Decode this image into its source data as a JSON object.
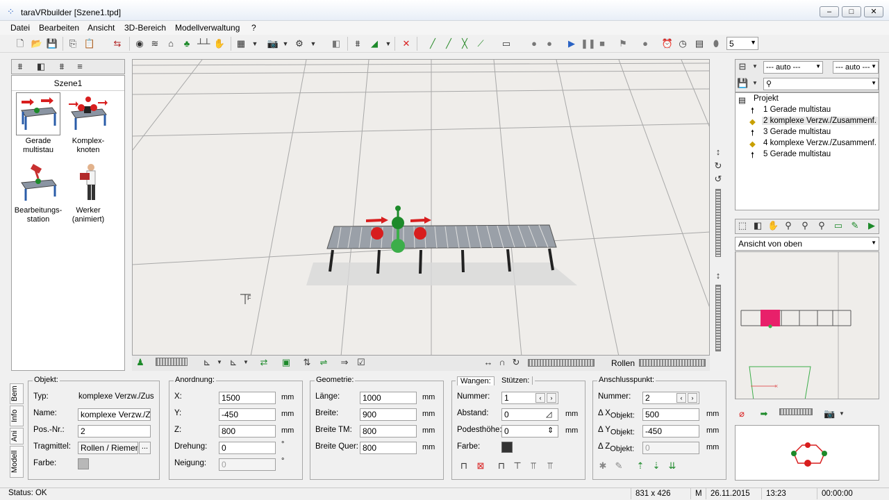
{
  "window": {
    "title": "taraVRbuilder [Szene1.tpd]"
  },
  "menu": [
    "Datei",
    "Bearbeiten",
    "Ansicht",
    "3D-Bereich",
    "Modellverwaltung",
    "?"
  ],
  "toolbar": {
    "count_value": "5"
  },
  "library": {
    "scene_label": "Szene1",
    "items": [
      {
        "label1": "Gerade",
        "label2": "multistau"
      },
      {
        "label1": "Komplex-",
        "label2": "knoten"
      },
      {
        "label1": "Bearbeitungs-",
        "label2": "station"
      },
      {
        "label1": "Werker",
        "label2": "(animiert)"
      }
    ]
  },
  "viewport": {
    "rollen_label": "Rollen"
  },
  "side_tabs": [
    "Bem",
    "Info",
    "Ani",
    "Modell"
  ],
  "objekt": {
    "title": "Objekt:",
    "typ_label": "Typ:",
    "typ_value": "komplexe Verzw./Zus",
    "name_label": "Name:",
    "name_value": "komplexe Verzw./Zus",
    "pos_label": "Pos.-Nr.:",
    "pos_value": "2",
    "tragmittel_label": "Tragmittel:",
    "tragmittel_value": "Rollen / Riemen",
    "farbe_label": "Farbe:"
  },
  "anordnung": {
    "title": "Anordnung:",
    "x_label": "X:",
    "x_value": "1500",
    "y_label": "Y:",
    "y_value": "-450",
    "z_label": "Z:",
    "z_value": "800",
    "drehung_label": "Drehung:",
    "drehung_value": "0",
    "neigung_label": "Neigung:",
    "neigung_value": "0",
    "unit_mm": "mm",
    "unit_deg": "°"
  },
  "geometrie": {
    "title": "Geometrie:",
    "laenge_label": "Länge:",
    "laenge_value": "1000",
    "breite_label": "Breite:",
    "breite_value": "900",
    "breite_tm_label": "Breite TM:",
    "breite_tm_value": "800",
    "breite_quer_label": "Breite Quer:",
    "breite_quer_value": "800",
    "unit_mm": "mm"
  },
  "wangen": {
    "tab1": "Wangen:",
    "tab2": "Stützen:",
    "nummer_label": "Nummer:",
    "nummer_value": "1",
    "abstand_label": "Abstand:",
    "abstand_value": "0",
    "podest_label": "Podesthöhe:",
    "podest_value": "0",
    "farbe_label": "Farbe:",
    "unit_mm": "mm"
  },
  "anschluss": {
    "title": "Anschlusspunkt:",
    "nummer_label": "Nummer:",
    "nummer_value": "2",
    "dx_label": "Δ X",
    "dx_sub": "Objekt:",
    "dx_value": "500",
    "dy_label": "Δ Y",
    "dy_sub": "Objekt:",
    "dy_value": "-450",
    "dz_label": "Δ Z",
    "dz_sub": "Objekt:",
    "dz_value": "0",
    "unit_mm": "mm"
  },
  "project_panel": {
    "auto1": "--- auto ---",
    "auto2": "--- auto ---",
    "root": "Projekt",
    "items": [
      {
        "label": "1  Gerade multistau"
      },
      {
        "label": "2  komplexe Verzw./Zusammenf."
      },
      {
        "label": "3  Gerade multistau"
      },
      {
        "label": "4  komplexe Verzw./Zusammenf."
      },
      {
        "label": "5  Gerade multistau"
      }
    ]
  },
  "view_panel": {
    "view_select": "Ansicht von oben"
  },
  "status": {
    "text": "Status: OK",
    "size": "831 x 426",
    "mode": "M",
    "date": "26.11.2015",
    "time": "13:23",
    "timer": "00:00:00"
  },
  "colors": {
    "accent_magenta": "#e8206a",
    "conveyor_red": "#d81e1e",
    "conveyor_green": "#1d8a2a"
  }
}
